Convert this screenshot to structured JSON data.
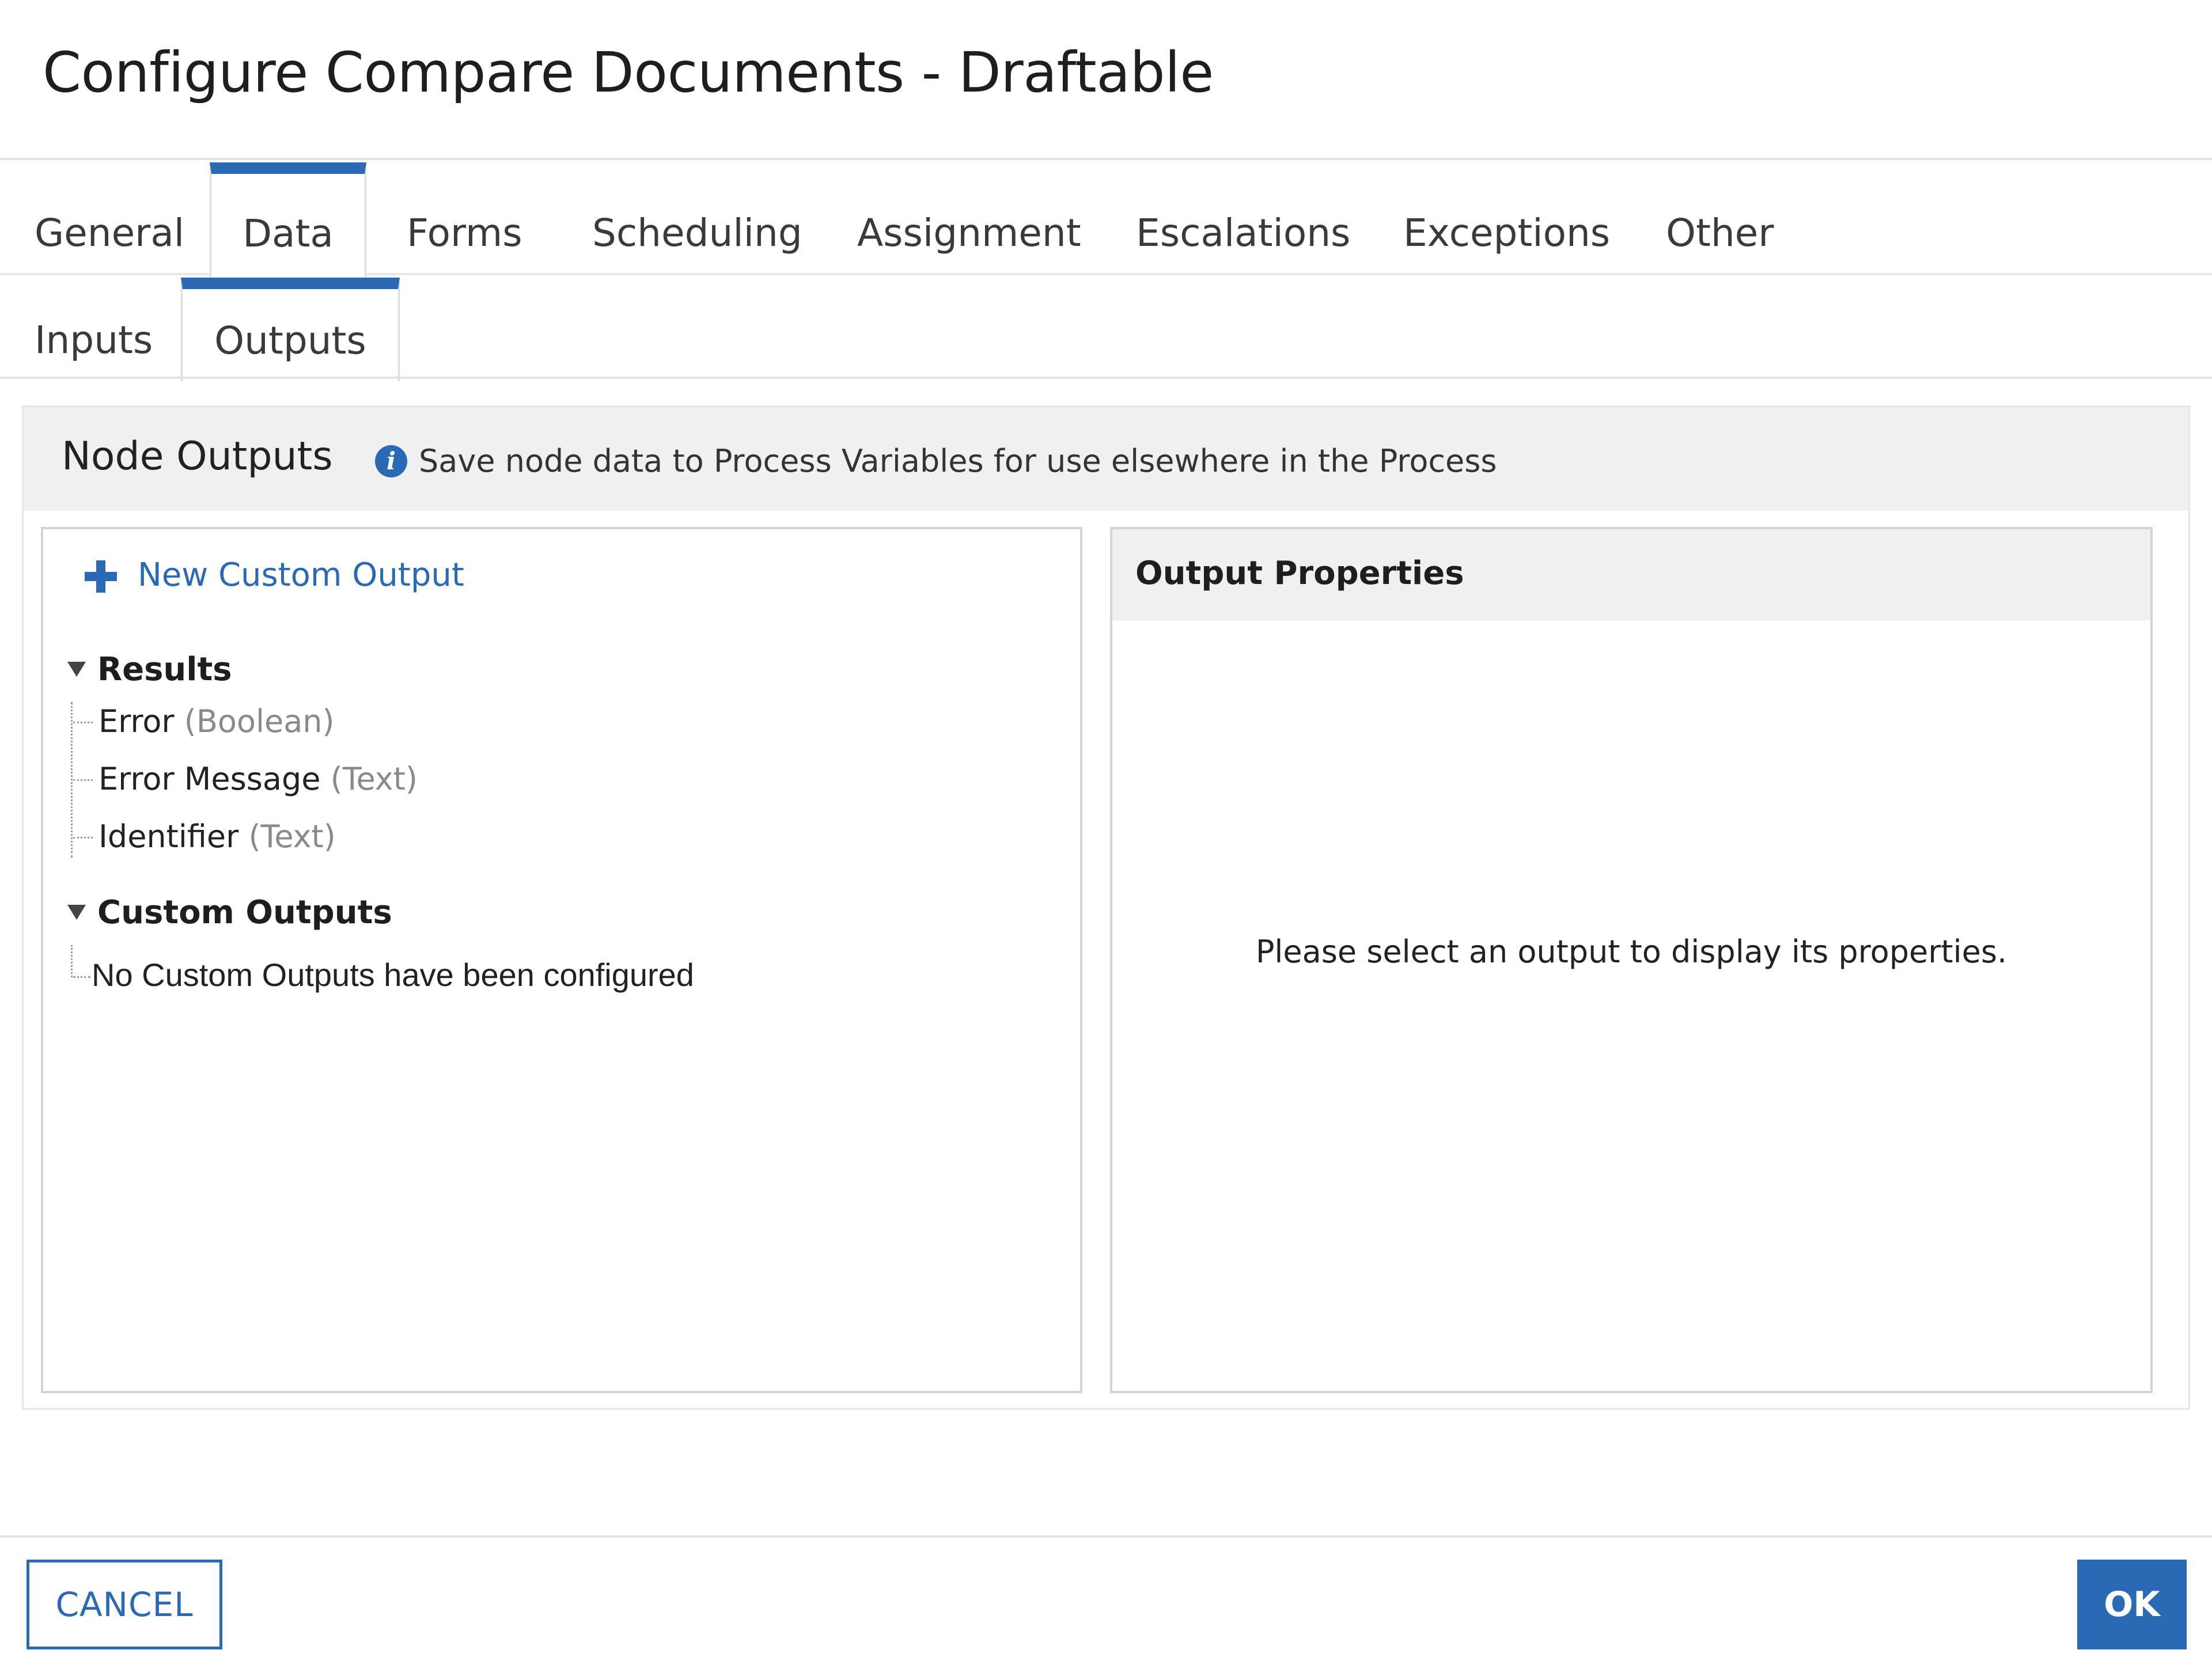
{
  "dialog": {
    "title": "Configure Compare Documents - Draftable"
  },
  "tabs": [
    {
      "label": "General",
      "active": false
    },
    {
      "label": "Data",
      "active": true
    },
    {
      "label": "Forms",
      "active": false
    },
    {
      "label": "Scheduling",
      "active": false
    },
    {
      "label": "Assignment",
      "active": false
    },
    {
      "label": "Escalations",
      "active": false
    },
    {
      "label": "Exceptions",
      "active": false
    },
    {
      "label": "Other",
      "active": false
    }
  ],
  "subtabs": [
    {
      "label": "Inputs",
      "active": false
    },
    {
      "label": "Outputs",
      "active": true
    }
  ],
  "node_outputs": {
    "title": "Node Outputs",
    "info_icon": "info-icon",
    "hint": "Save node data to Process Variables for use elsewhere in the Process",
    "new_custom_output": {
      "icon": "plus-icon",
      "label": "New Custom Output"
    },
    "groups": [
      {
        "label": "Results",
        "expanded": true,
        "items": [
          {
            "name": "Error",
            "type": "(Boolean)"
          },
          {
            "name": "Error Message",
            "type": "(Text)"
          },
          {
            "name": "Identifier",
            "type": "(Text)"
          }
        ]
      },
      {
        "label": "Custom Outputs",
        "expanded": true,
        "empty_text": "No Custom Outputs have been configured"
      }
    ]
  },
  "output_properties": {
    "title": "Output Properties",
    "empty_text": "Please select an output to display its properties."
  },
  "footer": {
    "cancel_label": "CANCEL",
    "ok_label": "OK"
  },
  "colors": {
    "accent": "#2a6ab5",
    "panel_header_bg": "#f0f0f0",
    "muted_type_text": "#8a8a8a"
  }
}
